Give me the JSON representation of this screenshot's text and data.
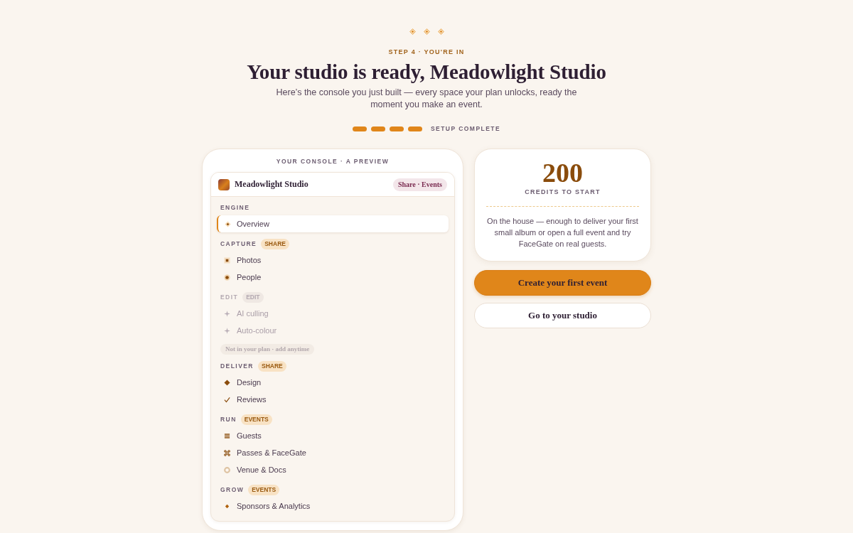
{
  "eyebrow": "STEP 4 · YOU'RE IN",
  "title": "Your studio is ready, Meadowlight Studio",
  "subtitle": "Here’s the console you just built — every space your plan unlocks, ready the moment you make an event.",
  "progress": {
    "steps": [
      {
        "done": true
      },
      {
        "done": true
      },
      {
        "done": true
      },
      {
        "done": true
      }
    ],
    "label": "SETUP COMPLETE"
  },
  "console": {
    "caption": "YOUR CONSOLE · A PREVIEW",
    "studio_name": "Meadowlight Studio",
    "plan_badge": "Share · Events",
    "sections": [
      {
        "label": "ENGINE",
        "disabled": false,
        "items": [
          {
            "label": "Overview",
            "selected": true
          }
        ]
      },
      {
        "label": "CAPTURE",
        "badge": "SHARE",
        "disabled": false,
        "items": [
          {
            "label": "Photos",
            "selected": false
          },
          {
            "label": "People",
            "selected": false
          }
        ]
      },
      {
        "label": "EDIT",
        "badge": "EDIT",
        "disabled": true,
        "items": [
          {
            "label": "AI culling",
            "selected": false
          },
          {
            "label": "Auto-colour",
            "selected": false
          }
        ],
        "note": "Not in your plan · add anytime"
      },
      {
        "label": "DELIVER",
        "badge": "SHARE",
        "disabled": false,
        "items": [
          {
            "label": "Design",
            "selected": false
          },
          {
            "label": "Reviews",
            "selected": false
          }
        ]
      },
      {
        "label": "RUN",
        "badge": "EVENTS",
        "disabled": false,
        "items": [
          {
            "label": "Guests",
            "selected": false
          },
          {
            "label": "Passes & FaceGate",
            "selected": false
          },
          {
            "label": "Venue & Docs",
            "selected": false
          }
        ]
      },
      {
        "label": "GROW",
        "badge": "EVENTS",
        "disabled": false,
        "items": [
          {
            "label": "Sponsors & Analytics",
            "selected": false
          }
        ]
      }
    ]
  },
  "credits": {
    "amount": "200",
    "label": "CREDITS TO START",
    "description": "On the house — enough to deliver your first small album or open a full event and try FaceGate on real guests."
  },
  "actions": [
    {
      "label": "Create your first event",
      "kind": "primary"
    },
    {
      "label": "Go to your studio",
      "kind": "secondary"
    }
  ]
}
